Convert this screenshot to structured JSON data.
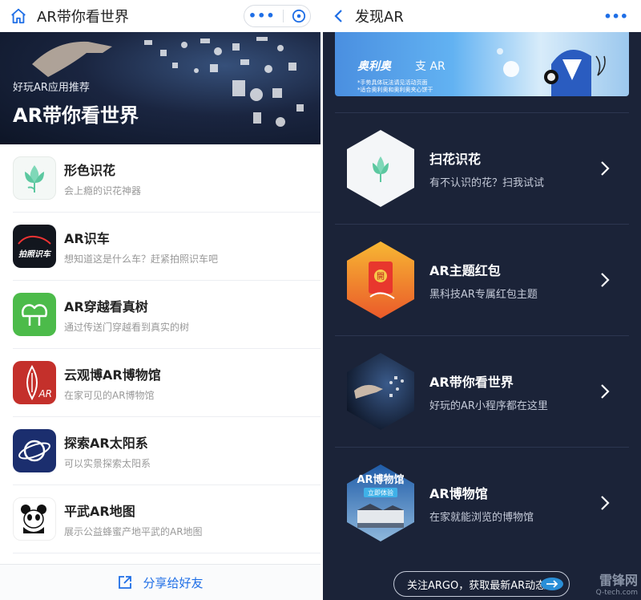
{
  "left": {
    "header": {
      "title": "AR带你看世界",
      "more_icon": "more-dots-icon",
      "close_icon": "close-circle-icon"
    },
    "banner": {
      "subtitle": "好玩AR应用推荐",
      "title": "AR带你看世界"
    },
    "items": [
      {
        "title": "形色识花",
        "desc": "会上瘾的识花神器",
        "icon": "flower-icon"
      },
      {
        "title": "AR识车",
        "desc": "想知道这是什么车？赶紧拍照识车吧",
        "icon": "car-icon",
        "icon_text": "拍照识车"
      },
      {
        "title": "AR穿越看真树",
        "desc": "通过传送门穿越看到真实的树",
        "icon": "tree-icon"
      },
      {
        "title": "云观博AR博物馆",
        "desc": "在家可见的AR博物馆",
        "icon": "museum-icon",
        "icon_text": "AR"
      },
      {
        "title": "探索AR太阳系",
        "desc": "可以实景探索太阳系",
        "icon": "planet-icon"
      },
      {
        "title": "平武AR地图",
        "desc": "展示公益蜂蜜产地平武的AR地图",
        "icon": "panda-icon"
      }
    ],
    "share": {
      "label": "分享给好友"
    }
  },
  "right": {
    "header": {
      "title": "发现AR",
      "more": "•••"
    },
    "promo": {
      "brand": "奥利奥",
      "ar_label": "支 AR",
      "fine_print_1": "*手势具体玩法请见活动页面",
      "fine_print_2": "*适合奥利奥和奥利奥夹心饼干"
    },
    "items": [
      {
        "title": "扫花识花",
        "desc": "有不认识的花？扫我试试",
        "icon": "flower-hex-icon"
      },
      {
        "title": "AR主题红包",
        "desc": "黑科技AR专属红包主题",
        "icon": "red-envelope-icon",
        "icon_text": "開"
      },
      {
        "title": "AR带你看世界",
        "desc": "好玩的AR小程序都在这里",
        "icon": "world-hex-icon"
      },
      {
        "title": "AR博物馆",
        "desc": "在家就能浏览的博物馆",
        "icon": "museum-hex-icon",
        "icon_title": "AR博物馆",
        "icon_btn": "立即体验"
      }
    ],
    "follow": {
      "label": "关注ARGO，获取最新AR动态"
    },
    "watermark": {
      "cn": "雷锋网",
      "en": "Q-tech.com"
    }
  },
  "colors": {
    "accent": "#1e6ee6",
    "dark_bg": "#1b2338",
    "red": "#e8372d"
  }
}
